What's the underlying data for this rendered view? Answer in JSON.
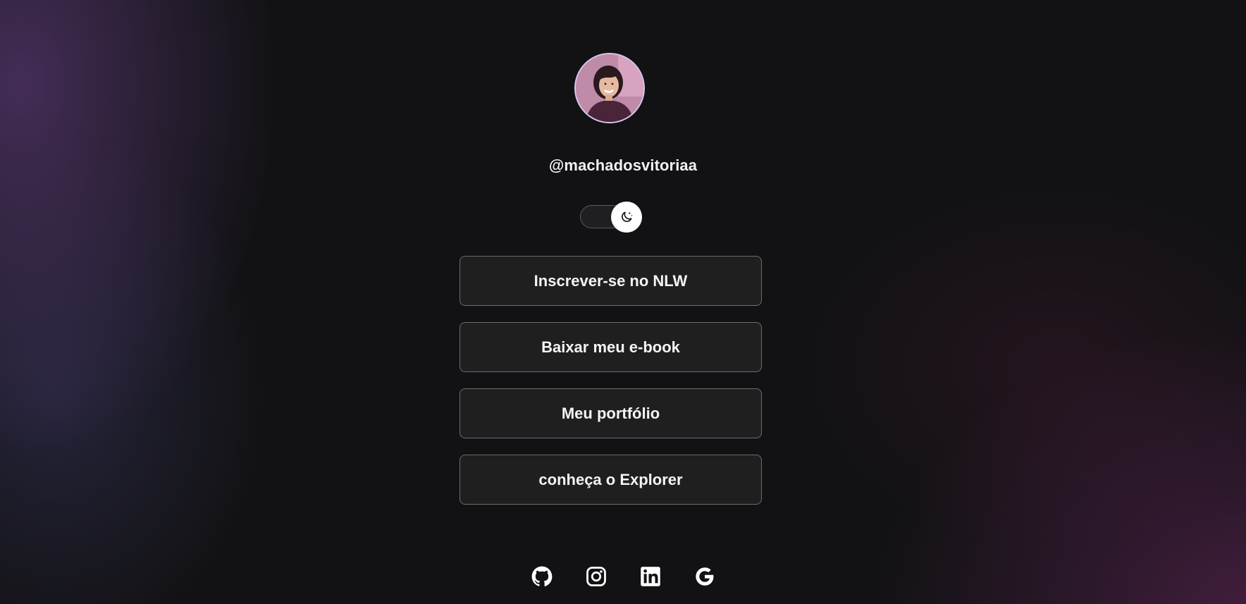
{
  "profile": {
    "username": "@machadosvitoriaa",
    "avatar_icon": "profile-photo"
  },
  "theme_toggle": {
    "icon": "moon-stars-icon",
    "state": "dark"
  },
  "links": [
    {
      "label": "Inscrever-se no NLW"
    },
    {
      "label": "Baixar meu e-book"
    },
    {
      "label": "Meu portfólio"
    },
    {
      "label": "conheça o Explorer"
    }
  ],
  "socials": [
    {
      "name": "github-icon"
    },
    {
      "name": "instagram-icon"
    },
    {
      "name": "linkedin-icon"
    },
    {
      "name": "google-icon"
    }
  ],
  "colors": {
    "background": "#121214",
    "accent_purple": "#623e80",
    "text": "#f4f4f5",
    "button_border": "#6b6b72"
  }
}
